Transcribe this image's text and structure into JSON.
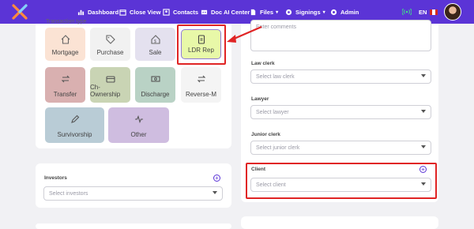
{
  "nav": {
    "items": [
      {
        "label": "Dashboard",
        "icon": "dashboard-icon"
      },
      {
        "label": "Close View",
        "icon": "calendar-icon"
      },
      {
        "label": "Contacts",
        "icon": "contacts-icon"
      },
      {
        "label": "Doc AI Center",
        "icon": "doc-ai-icon"
      },
      {
        "label": "Files",
        "icon": "files-icon"
      },
      {
        "label": "Signings",
        "icon": "signings-icon"
      },
      {
        "label": "Admin",
        "icon": "admin-icon"
      }
    ],
    "lang": "EN"
  },
  "transaction": {
    "header": "Transaction type",
    "tiles": [
      {
        "label": "Mortgage",
        "color": "#fbe3d4"
      },
      {
        "label": "Purchase",
        "color": "#f1f1f1"
      },
      {
        "label": "Sale",
        "color": "#e4e1ef"
      },
      {
        "label": "LDR Rep",
        "color": "#e8f8a8"
      },
      {
        "label": "Transfer",
        "color": "#d9b0b0"
      },
      {
        "label": "Ch-Ownership",
        "color": "#c9d4b4"
      },
      {
        "label": "Discharge",
        "color": "#b9d2c5"
      },
      {
        "label": "Reverse-M",
        "color": "#f4f4f4"
      },
      {
        "label": "Survivorship",
        "color": "#b9ccd6"
      },
      {
        "label": "Other",
        "color": "#cfbde0"
      }
    ]
  },
  "investors": {
    "label": "Investors",
    "placeholder": "Select investors"
  },
  "right": {
    "comments_placeholder": "Enter comments",
    "law_clerk": {
      "label": "Law clerk",
      "placeholder": "Select law clerk"
    },
    "lawyer": {
      "label": "Lawyer",
      "placeholder": "Select lawyer"
    },
    "junior_clerk": {
      "label": "Junior clerk",
      "placeholder": "Select junior clerk"
    },
    "client": {
      "label": "Client",
      "placeholder": "Select client"
    }
  },
  "colors": {
    "brand": "#5b34d6",
    "highlight": "#e02424"
  }
}
